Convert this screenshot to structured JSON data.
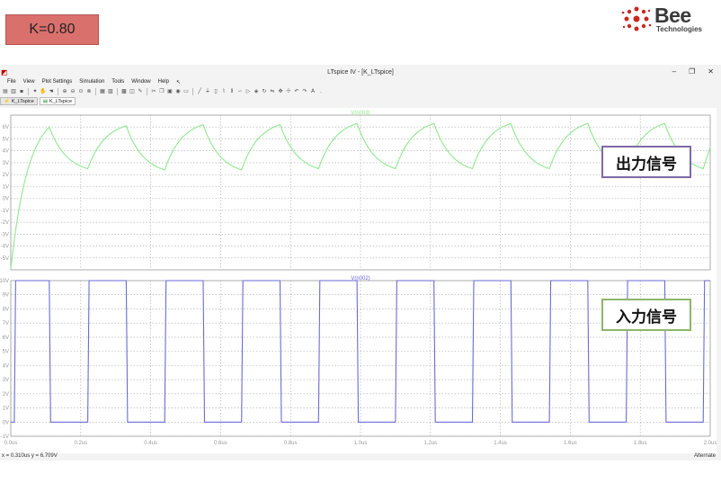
{
  "slide": {
    "k_label": "K=0.80",
    "logo_main": "Bee",
    "logo_sub": "Technologies",
    "output_label": "出力信号",
    "input_label": "入力信号"
  },
  "window": {
    "title": "LTspice IV - [K_LTspice]",
    "minimize": "–",
    "restore": "❐",
    "close": "✕"
  },
  "menu": [
    "File",
    "View",
    "Plot Settings",
    "Simulation",
    "Tools",
    "Window",
    "Help"
  ],
  "tabs": [
    {
      "label": "K_LTspice"
    },
    {
      "label": "K_LTspice"
    }
  ],
  "status": {
    "readout": "x = 0.310us   y = 6.709V",
    "mode": "Alternate"
  },
  "colors": {
    "output_trace": "#8fe88f",
    "input_trace": "#6b6bd6",
    "k_badge": "#d9706c",
    "output_label_border": "#7d6aa6",
    "input_label_border": "#8fb56a"
  },
  "chart_data": [
    {
      "type": "line",
      "title": "V(n003)",
      "series": [
        {
          "name": "V(n003)",
          "note_period_us": 0.22
        }
      ],
      "x_ticks": [
        "0.0us",
        "0.2us",
        "0.4us",
        "0.6us",
        "0.8us",
        "1.0us",
        "1.2us",
        "1.4us",
        "1.6us",
        "1.8us",
        "2.0us"
      ],
      "xlim": [
        0,
        2.0
      ],
      "y_ticks": [
        "6V",
        "5V",
        "4V",
        "3V",
        "2V",
        "1V",
        "0V",
        "-1V",
        "-2V",
        "-3V",
        "-4V",
        "-5V"
      ],
      "y_tick_values": [
        6,
        5,
        4,
        3,
        2,
        1,
        0,
        -1,
        -2,
        -3,
        -4,
        -5
      ],
      "ylim": [
        -6,
        7
      ],
      "peaks": [
        {
          "x": 0.0,
          "y": -5.9
        },
        {
          "x": 0.11,
          "y": 6.0
        },
        {
          "x": 0.22,
          "y": 2.5
        },
        {
          "x": 0.33,
          "y": 6.1
        },
        {
          "x": 0.44,
          "y": 2.4
        },
        {
          "x": 0.55,
          "y": 6.2
        },
        {
          "x": 0.66,
          "y": 2.4
        },
        {
          "x": 0.77,
          "y": 6.2
        },
        {
          "x": 0.88,
          "y": 2.5
        },
        {
          "x": 0.99,
          "y": 6.3
        },
        {
          "x": 1.1,
          "y": 2.5
        },
        {
          "x": 1.21,
          "y": 6.3
        },
        {
          "x": 1.32,
          "y": 2.5
        },
        {
          "x": 1.43,
          "y": 6.3
        },
        {
          "x": 1.54,
          "y": 2.5
        },
        {
          "x": 1.65,
          "y": 6.3
        },
        {
          "x": 1.76,
          "y": 2.5
        },
        {
          "x": 1.87,
          "y": 6.3
        },
        {
          "x": 1.98,
          "y": 2.5
        }
      ],
      "grid": true
    },
    {
      "type": "line",
      "title": "V(n002)",
      "series": [
        {
          "name": "V(n002)"
        }
      ],
      "x_ticks": [
        "0.0us",
        "0.2us",
        "0.4us",
        "0.6us",
        "0.8us",
        "1.0us",
        "1.2us",
        "1.4us",
        "1.6us",
        "1.8us",
        "2.0us"
      ],
      "xlim": [
        0,
        2.0
      ],
      "y_ticks": [
        "10V",
        "9V",
        "8V",
        "7V",
        "6V",
        "5V",
        "4V",
        "3V",
        "2V",
        "1V",
        "0V",
        "-1V"
      ],
      "y_tick_values": [
        10,
        9,
        8,
        7,
        6,
        5,
        4,
        3,
        2,
        1,
        0,
        -1
      ],
      "ylim": [
        -1,
        10
      ],
      "high": 10,
      "low": 0,
      "period_us": 0.22,
      "transitions_us": [
        0.0,
        0.01,
        0.11,
        0.22,
        0.33,
        0.44,
        0.55,
        0.66,
        0.77,
        0.88,
        0.99,
        1.1,
        1.21,
        1.32,
        1.43,
        1.54,
        1.65,
        1.76,
        1.87,
        1.98
      ],
      "grid": true
    }
  ]
}
